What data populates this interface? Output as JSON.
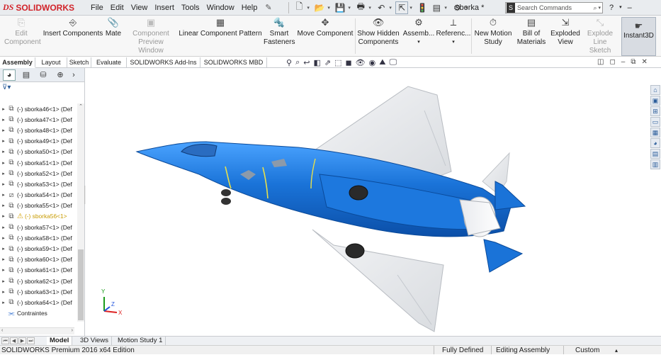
{
  "app": {
    "brand": "SOLIDWORKS",
    "brand_mark": "DS",
    "doc_title": "sborka *"
  },
  "menu": [
    "File",
    "Edit",
    "View",
    "Insert",
    "Tools",
    "Window",
    "Help"
  ],
  "search": {
    "placeholder": "Search Commands"
  },
  "help": {
    "label": "?",
    "minimize": "–"
  },
  "ribbon": {
    "edit_component": "Edit Component",
    "insert_components": "Insert Components",
    "mate": "Mate",
    "component_preview": "Component Preview Window",
    "linear_pattern": "Linear Component Pattern",
    "smart_fasteners": "Smart Fasteners",
    "move_component": "Move Component",
    "show_hidden": "Show Hidden Components",
    "assembly_features": "Assemb...",
    "reference_geometry": "Referenc...",
    "new_motion_study": "New Motion Study",
    "bill_of_materials": "Bill of Materials",
    "exploded_view": "Exploded View",
    "explode_line_sketch": "Explode Line Sketch",
    "instant3d": "Instant3D"
  },
  "tabs": [
    "Assembly",
    "Layout",
    "Sketch",
    "Evaluate",
    "SOLIDWORKS Add-Ins",
    "SOLIDWORKS MBD"
  ],
  "tree": {
    "items": [
      {
        "label": "(-) sborka46<1> (Def",
        "state": "normal"
      },
      {
        "label": "(-) sborka47<1> (Def",
        "state": "normal"
      },
      {
        "label": "(-) sborka48<1> (Def",
        "state": "normal"
      },
      {
        "label": "(-) sborka49<1> (Def",
        "state": "normal"
      },
      {
        "label": "(-) sborka50<1> (Def",
        "state": "normal"
      },
      {
        "label": "(-) sborka51<1> (Def",
        "state": "normal"
      },
      {
        "label": "(-) sborka52<1> (Def",
        "state": "normal"
      },
      {
        "label": "(-) sborka53<1> (Def",
        "state": "normal"
      },
      {
        "label": "(-) sborka54<1> (Def",
        "state": "suppressed"
      },
      {
        "label": "(-) sborka55<1> (Def",
        "state": "normal"
      },
      {
        "label": "(-) sborka56<1>",
        "state": "warning"
      },
      {
        "label": "(-) sborka57<1> (Def",
        "state": "normal"
      },
      {
        "label": "(-) sborka58<1> (Def",
        "state": "normal"
      },
      {
        "label": "(-) sborka59<1> (Def",
        "state": "normal"
      },
      {
        "label": "(-) sborka60<1> (Def",
        "state": "normal"
      },
      {
        "label": "(-) sborka61<1> (Def",
        "state": "normal"
      },
      {
        "label": "(-) sborka62<1> (Def",
        "state": "normal"
      },
      {
        "label": "(-) sborka63<1> (Def",
        "state": "normal"
      },
      {
        "label": "(-) sborka64<1> (Def",
        "state": "normal"
      }
    ],
    "mates_label": "Contraintes"
  },
  "bottom_tabs": [
    "Model",
    "3D Views",
    "Motion Study 1"
  ],
  "status": {
    "edition": "SOLIDWORKS Premium 2016 x64 Edition",
    "defined": "Fully Defined",
    "mode": "Editing Assembly",
    "units": "Custom"
  },
  "triad": {
    "x": "X",
    "y": "Y",
    "z": "Z"
  },
  "colors": {
    "model_blue": "#1a73d8",
    "brand_red": "#d2232a",
    "wing_grey": "#e4e6ea"
  }
}
